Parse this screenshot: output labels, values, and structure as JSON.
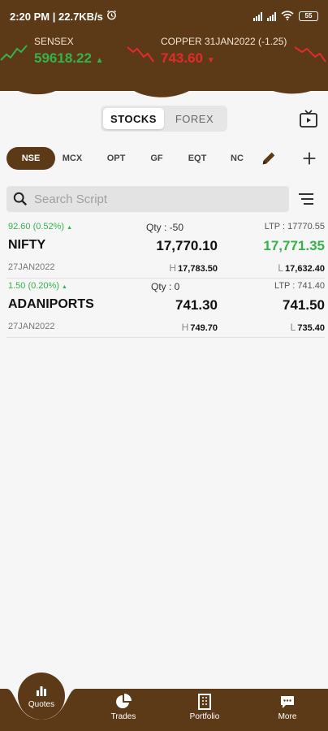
{
  "status": {
    "time_speed": "2:20 PM | 22.7KB/s",
    "battery": "55"
  },
  "ticker": [
    {
      "label": "SENSEX",
      "value": "59618.22",
      "direction": "up",
      "color": "#35b24a"
    },
    {
      "label": "COPPER 31JAN2022 (-1.25)",
      "value": "743.60",
      "direction": "down",
      "color": "#e12b2b"
    }
  ],
  "segment": {
    "stocks_label": "STOCKS",
    "forex_label": "FOREX",
    "active": "STOCKS"
  },
  "chips": [
    "NSE",
    "MCX",
    "OPT",
    "GF",
    "EQT",
    "NC"
  ],
  "active_chip": "NSE",
  "search": {
    "placeholder": "Search Script"
  },
  "quotes": [
    {
      "change": "92.60 (0.52%)",
      "qty": "Qty : -50",
      "ltp": "LTP : 17770.55",
      "name": "NIFTY",
      "bid": "17,770.10",
      "ask": "17,771.35",
      "ask_color": "#35b24a",
      "date": "27JAN2022",
      "high_prefix": "H",
      "high": "17,783.50",
      "low_prefix": "L",
      "low": "17,632.40"
    },
    {
      "change": "1.50 (0.20%)",
      "qty": "Qty : 0",
      "ltp": "LTP : 741.40",
      "name": "ADANIPORTS",
      "bid": "741.30",
      "ask": "741.50",
      "ask_color": "#111111",
      "date": "27JAN2022",
      "high_prefix": "H",
      "high": "749.70",
      "low_prefix": "L",
      "low": "735.40"
    }
  ],
  "nav": {
    "quotes": "Quotes",
    "trades": "Trades",
    "portfolio": "Portfolio",
    "more": "More"
  },
  "colors": {
    "brand": "#5c3a17",
    "up": "#35b24a",
    "down": "#e12b2b"
  }
}
